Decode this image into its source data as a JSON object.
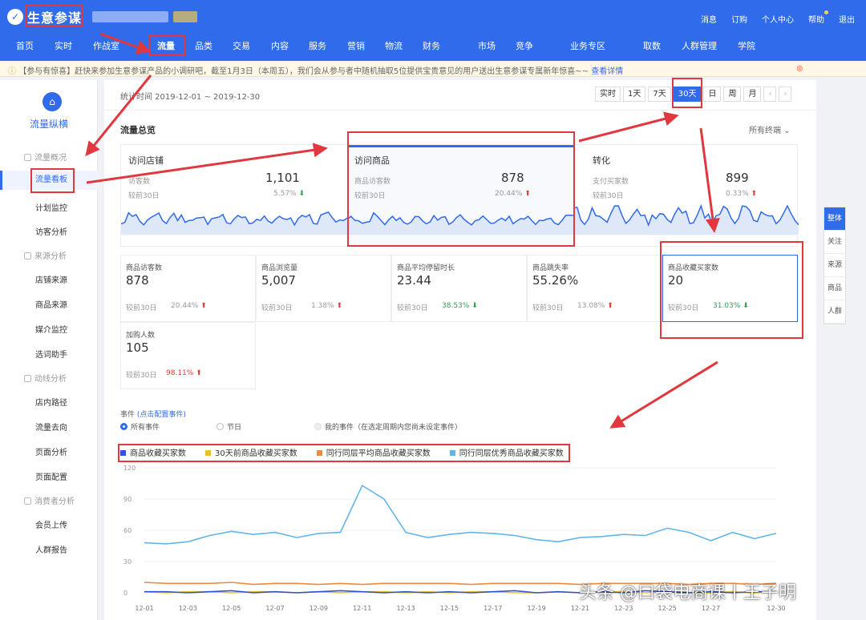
{
  "header": {
    "app_title": "生意参谋",
    "top_links": [
      "消息",
      "订购",
      "个人中心",
      "帮助",
      "退出"
    ]
  },
  "nav": {
    "items": [
      "首页",
      "实时",
      "作战室",
      "流量",
      "品类",
      "交易",
      "内容",
      "服务",
      "营销",
      "物流",
      "财务",
      "市场",
      "竞争",
      "业务专区",
      "取数",
      "人群管理",
      "学院"
    ],
    "active": "流量"
  },
  "notice": {
    "text": "【参与有惊喜】赶快来参加生意参谋产品的小调研吧，截至1月3日（本周五），我们会从参与者中随机抽取5位提供宝贵意见的用户送出生意参谋专属新年惊喜~~",
    "link": "查看详情",
    "close_icon": "close-circle-icon"
  },
  "sidebar": {
    "title": "流量纵横",
    "groups": [
      {
        "label": "流量概况",
        "items": [
          "流量看板",
          "计划监控",
          "访客分析"
        ]
      },
      {
        "label": "来源分析",
        "items": [
          "店铺来源",
          "商品来源",
          "媒介监控",
          "选词助手"
        ]
      },
      {
        "label": "动线分析",
        "items": [
          "店内路径",
          "流量去向",
          "页面分析",
          "页面配置"
        ]
      },
      {
        "label": "消费者分析",
        "items": [
          "会员上传",
          "人群报告"
        ]
      }
    ],
    "active_item": "流量看板"
  },
  "toolbar": {
    "stat_time": "统计时间 2019-12-01 ~ 2019-12-30",
    "periods": [
      "实时",
      "1天",
      "7天",
      "30天",
      "日",
      "周",
      "月"
    ],
    "active_period": "30天",
    "prev_icon": "chevron-left-icon",
    "next_icon": "chevron-right-icon"
  },
  "overview": {
    "title": "流量总览",
    "terminal_select": "所有终端",
    "cards": [
      {
        "name": "访问店铺",
        "metric": "访客数",
        "value": "1,101",
        "compare": "较前30日",
        "pct": "5.57%",
        "trend": "down"
      },
      {
        "name": "访问商品",
        "metric": "商品访客数",
        "value": "878",
        "compare": "较前30日",
        "pct": "20.44%",
        "trend": "up"
      },
      {
        "name": "转化",
        "metric": "支付买家数",
        "value": "899",
        "compare": "较前30日",
        "pct": "0.33%",
        "trend": "up"
      }
    ]
  },
  "kpis": [
    {
      "label": "商品访客数",
      "value": "878",
      "compare": "较前30日",
      "pct": "20.44%",
      "trend": "up",
      "pct_color": "gray"
    },
    {
      "label": "商品浏览量",
      "value": "5,007",
      "compare": "较前30日",
      "pct": "1.38%",
      "trend": "up",
      "pct_color": "gray"
    },
    {
      "label": "商品平均停留时长",
      "value": "23.44",
      "compare": "较前30日",
      "pct": "38.53%",
      "trend": "down",
      "pct_color": "green"
    },
    {
      "label": "商品跳失率",
      "value": "55.26%",
      "compare": "较前30日",
      "pct": "13.08%",
      "trend": "up",
      "pct_color": "gray"
    },
    {
      "label": "商品收藏买家数",
      "value": "20",
      "compare": "较前30日",
      "pct": "31.03%",
      "trend": "down",
      "pct_color": "green"
    },
    {
      "label": "加购人数",
      "value": "105",
      "compare": "较前30日",
      "pct": "98.11%",
      "trend": "up",
      "pct_color": "red"
    }
  ],
  "events": {
    "label": "事件",
    "config_link": "(点击配置事件)",
    "options": [
      "所有事件",
      "节日",
      "我的事件（在选定周期内您尚未设定事件）"
    ]
  },
  "right_tabs": [
    "整体",
    "关注",
    "来源",
    "商品",
    "人群"
  ],
  "colors": {
    "brand": "#2f6bea",
    "annotation_red": "#e0383e",
    "up": "#e53935",
    "down": "#2e9e57"
  },
  "watermark": "头条 @口袋电商课丨王子明",
  "chart_data": {
    "type": "line",
    "x": [
      "12-01",
      "12-02",
      "12-03",
      "12-04",
      "12-05",
      "12-06",
      "12-07",
      "12-08",
      "12-09",
      "12-10",
      "12-11",
      "12-12",
      "12-13",
      "12-14",
      "12-15",
      "12-16",
      "12-17",
      "12-18",
      "12-19",
      "12-20",
      "12-21",
      "12-22",
      "12-23",
      "12-24",
      "12-25",
      "12-26",
      "12-27",
      "12-28",
      "12-29",
      "12-30"
    ],
    "x_ticks": [
      "12-01",
      "12-03",
      "12-05",
      "12-07",
      "12-09",
      "12-11",
      "12-13",
      "12-15",
      "12-17",
      "12-19",
      "12-21",
      "12-23",
      "12-25",
      "12-27",
      "12-30"
    ],
    "y_ticks": [
      0,
      30,
      60,
      90,
      120
    ],
    "ylim": [
      0,
      120
    ],
    "series": [
      {
        "name": "商品收藏买家数",
        "color": "#2f55d4",
        "values": [
          1,
          1,
          0,
          1,
          2,
          0,
          1,
          0,
          1,
          2,
          1,
          0,
          1,
          0,
          1,
          0,
          1,
          2,
          0,
          1,
          0,
          1,
          0,
          2,
          1,
          0,
          1,
          0,
          1,
          1
        ]
      },
      {
        "name": "30天前商品收藏买家数",
        "color": "#e6c229",
        "values": [
          1,
          0,
          1,
          1,
          0,
          1,
          1,
          0,
          1,
          0,
          1,
          1,
          0,
          1,
          0,
          1,
          1,
          0,
          0,
          1,
          0,
          1,
          1,
          0,
          1,
          0,
          0,
          1,
          0,
          1
        ]
      },
      {
        "name": "同行同层平均商品收藏买家数",
        "color": "#f08a3a",
        "values": [
          10,
          9,
          9,
          9,
          10,
          8,
          9,
          9,
          8,
          9,
          8,
          9,
          9,
          9,
          9,
          8,
          9,
          9,
          9,
          9,
          8,
          9,
          9,
          9,
          9,
          8,
          9,
          9,
          8,
          9
        ]
      },
      {
        "name": "同行同层优秀商品收藏买家数",
        "color": "#63b5e8",
        "values": [
          48,
          47,
          49,
          55,
          59,
          56,
          58,
          53,
          57,
          58,
          103,
          90,
          58,
          53,
          56,
          58,
          57,
          55,
          51,
          49,
          53,
          54,
          56,
          55,
          62,
          58,
          50,
          58,
          52,
          57
        ]
      }
    ]
  }
}
